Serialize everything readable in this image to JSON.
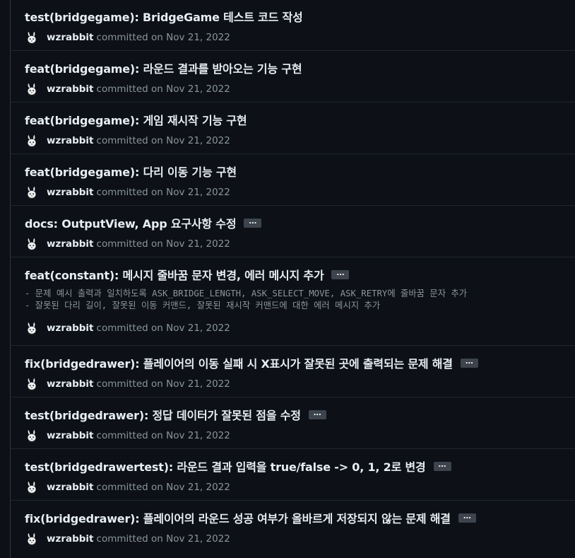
{
  "commits": [
    {
      "message": "test(bridgegame): BridgeGame 테스트 코드 작성",
      "has_more": false,
      "body": "",
      "author": "wzrabbit",
      "committed_text": "committed on Nov 21, 2022"
    },
    {
      "message": "feat(bridgegame): 라운드 결과를 받아오는 기능 구현",
      "has_more": false,
      "body": "",
      "author": "wzrabbit",
      "committed_text": "committed on Nov 21, 2022"
    },
    {
      "message": "feat(bridgegame): 게임 재시작 기능 구현",
      "has_more": false,
      "body": "",
      "author": "wzrabbit",
      "committed_text": "committed on Nov 21, 2022"
    },
    {
      "message": "feat(bridgegame): 다리 이동 기능 구현",
      "has_more": false,
      "body": "",
      "author": "wzrabbit",
      "committed_text": "committed on Nov 21, 2022"
    },
    {
      "message": "docs: OutputView, App 요구사항 수정",
      "has_more": true,
      "body": "",
      "author": "wzrabbit",
      "committed_text": "committed on Nov 21, 2022"
    },
    {
      "message": "feat(constant): 메시지 줄바꿈 문자 변경, 에러 메시지 추가",
      "has_more": true,
      "body": "- 문제 예시 출력과 일치하도록 ASK_BRIDGE_LENGTH, ASK_SELECT_MOVE, ASK_RETRY에 줄바꿈 문자 추가\n- 잘못된 다리 길이, 잘못된 이동 커맨드, 잘못된 재시작 커맨드에 대한 에러 메시지 추가",
      "author": "wzrabbit",
      "committed_text": "committed on Nov 21, 2022"
    },
    {
      "message": "fix(bridgedrawer): 플레이어의 이동 실패 시 X표시가 잘못된 곳에 출력되는 문제 해결",
      "has_more": true,
      "body": "",
      "author": "wzrabbit",
      "committed_text": "committed on Nov 21, 2022"
    },
    {
      "message": "test(bridgedrawer): 정답 데이터가 잘못된 점을 수정",
      "has_more": true,
      "body": "",
      "author": "wzrabbit",
      "committed_text": "committed on Nov 21, 2022"
    },
    {
      "message": "test(bridgedrawertest): 라운드 결과 입력을 true/false -> 0, 1, 2로 변경",
      "has_more": true,
      "body": "",
      "author": "wzrabbit",
      "committed_text": "committed on Nov 21, 2022"
    },
    {
      "message": "fix(bridgedrawer): 플레이어의 라운드 성공 여부가 올바르게 저장되지 않는 문제 해결",
      "has_more": true,
      "body": "",
      "author": "wzrabbit",
      "committed_text": "committed on Nov 21, 2022"
    }
  ],
  "ellipsis_label": "…",
  "avatar_icon": "rabbit-icon",
  "colors": {
    "background": "#0d1117",
    "border": "#21262d",
    "text_primary": "#e6edf3",
    "text_muted": "#8b949e",
    "ellipsis_bg": "#3d444d"
  }
}
